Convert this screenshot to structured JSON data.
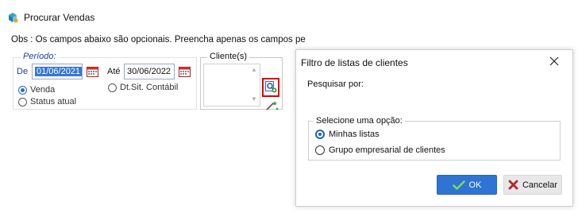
{
  "back_window": {
    "title": "Procurar Vendas",
    "obs_text": "Obs : Os campos abaixo são opcionais. Preencha apenas os campos pe",
    "periodo": {
      "legend": "Período:",
      "de_label": "De",
      "de_value": "01/06/2021",
      "ate_label": "Até",
      "ate_value": "30/06/2022",
      "radio_venda": "Venda",
      "radio_status": "Status atual",
      "radio_dtsit": "Dt.Sit. Contábil",
      "selected_radio": "Venda"
    },
    "cliente": {
      "legend": "Cliente(s)"
    }
  },
  "dialog": {
    "title": "Filtro de listas de clientes",
    "search_label": "Pesquisar por:",
    "group_legend": "Selecione uma opção:",
    "option_1": "Minhas listas",
    "option_2": "Grupo empresarial de clientes",
    "selected_option": "Minhas listas",
    "ok_label": "OK",
    "cancel_label": "Cancelar"
  },
  "icons": {
    "app": "app-icon",
    "calendar": "calendar-icon",
    "search_list": "search-list-icon",
    "wand": "magic-wand-icon",
    "close": "close-icon",
    "check": "check-icon",
    "cancel_x": "cancel-x-icon"
  },
  "colors": {
    "accent": "#2f73d4",
    "highlight_border": "#e00000",
    "label_blue": "#1a3fa8"
  }
}
